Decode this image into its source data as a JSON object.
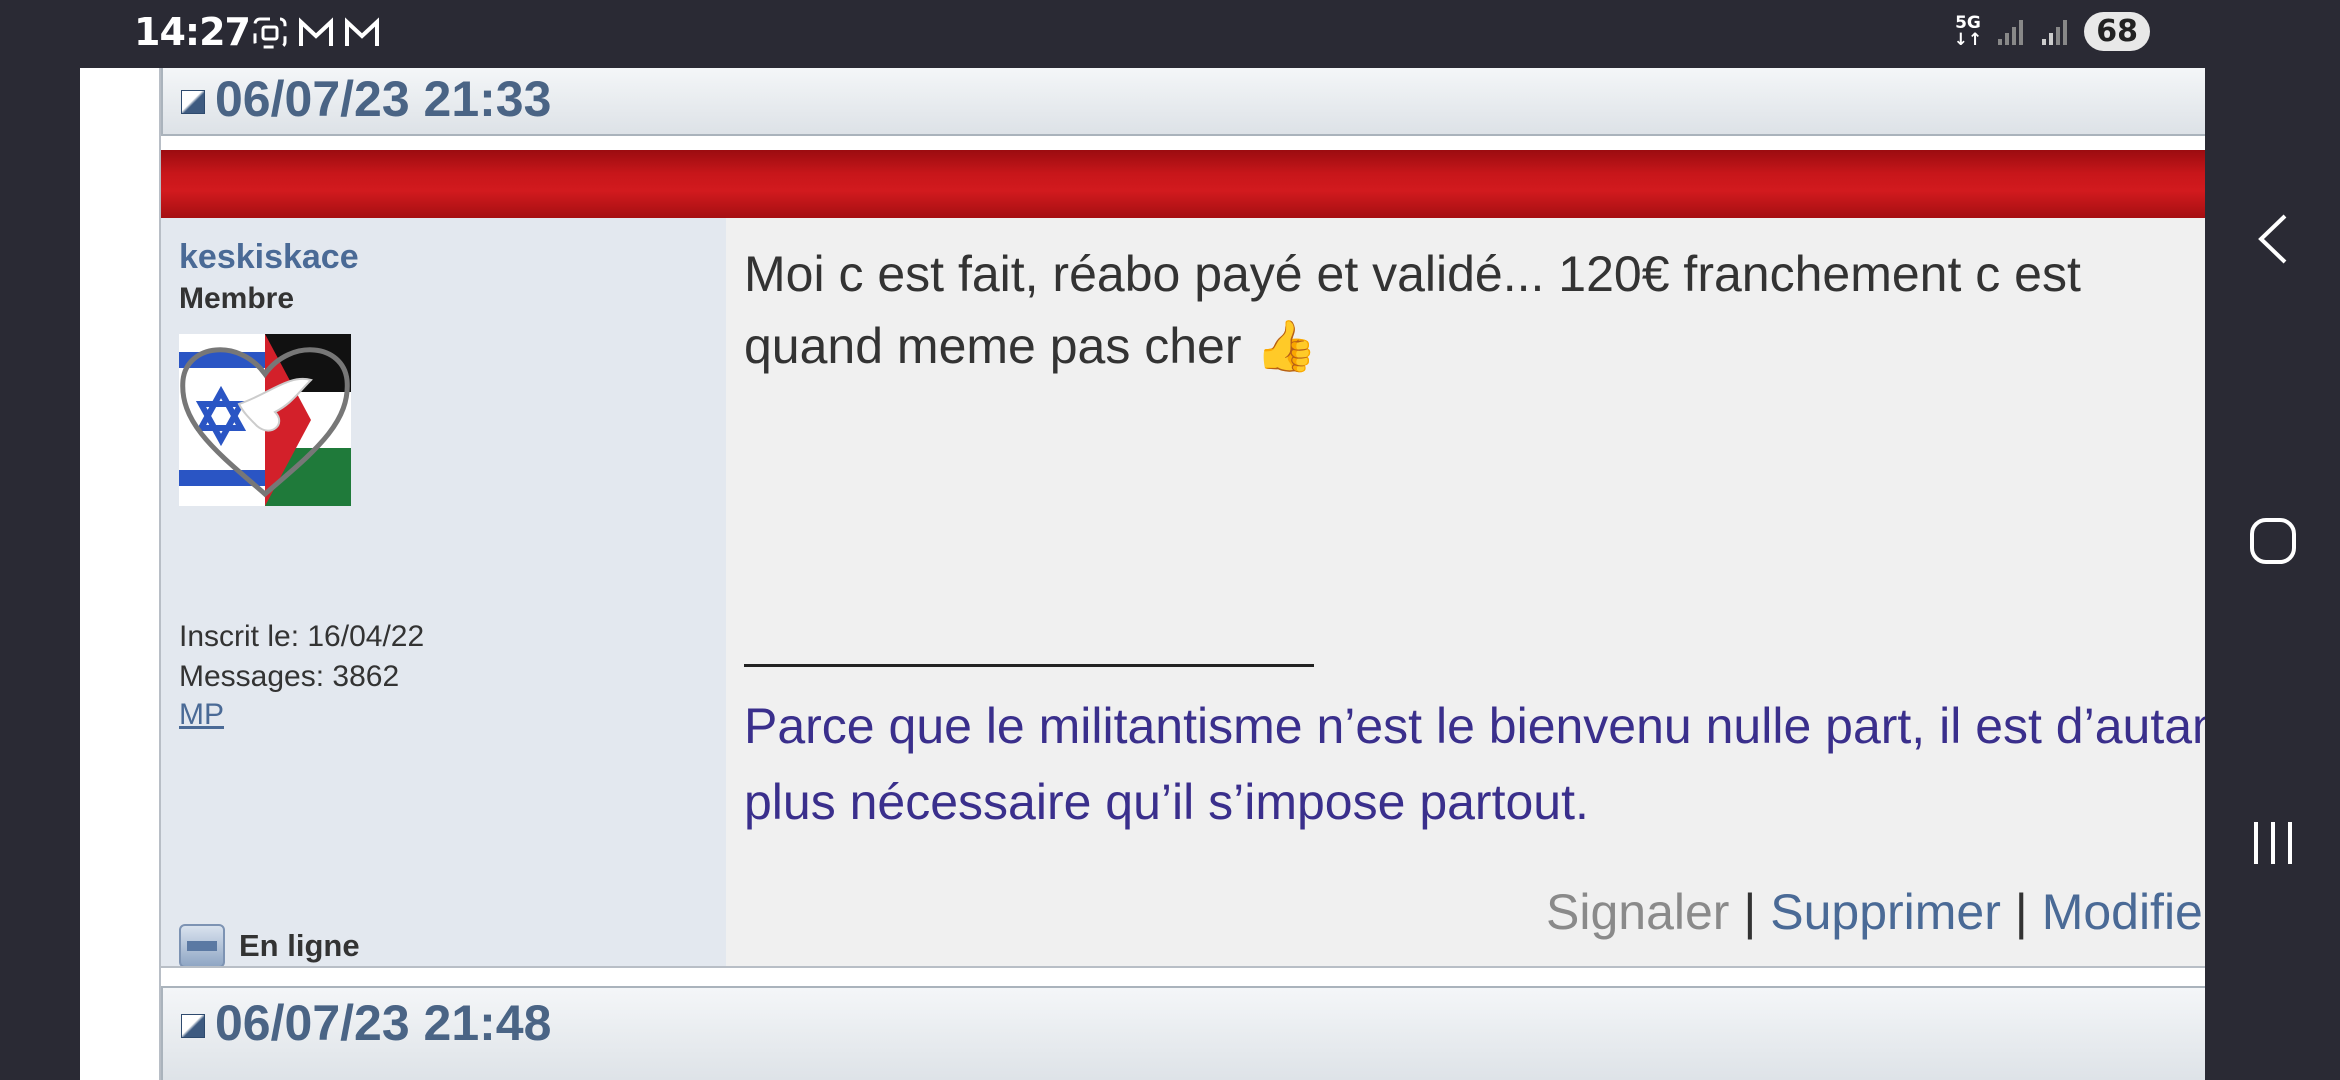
{
  "status_bar": {
    "time": "14:27",
    "network": "5G",
    "battery": "68"
  },
  "posts": [
    {
      "date": "06/07/23 21:33",
      "anchor": "#",
      "author": {
        "name": "keskiskace",
        "rank": "Membre",
        "joined": "Inscrit le: 16/04/22",
        "messages": "Messages: 3862",
        "pm_link": "MP",
        "status": "En ligne"
      },
      "message_line1": "Moi c est fait, réabo payé et validé... 120€ franchement c est",
      "message_line2": "quand meme pas cher 👍",
      "signature_line1": "Parce que le militantisme n’est le bienvenu nulle part, il est d’autant",
      "signature_line2": "plus nécessaire qu’il s’impose partout.",
      "actions": {
        "report": "Signaler",
        "delete": "Supprimer",
        "edit": "Modifier",
        "separator": "|"
      }
    },
    {
      "date": "06/07/23 21:48",
      "anchor": "#"
    }
  ],
  "colors": {
    "header_red": "#c8161a",
    "link_blue": "#4a6a96",
    "signature_purple": "#3a2f8c"
  }
}
